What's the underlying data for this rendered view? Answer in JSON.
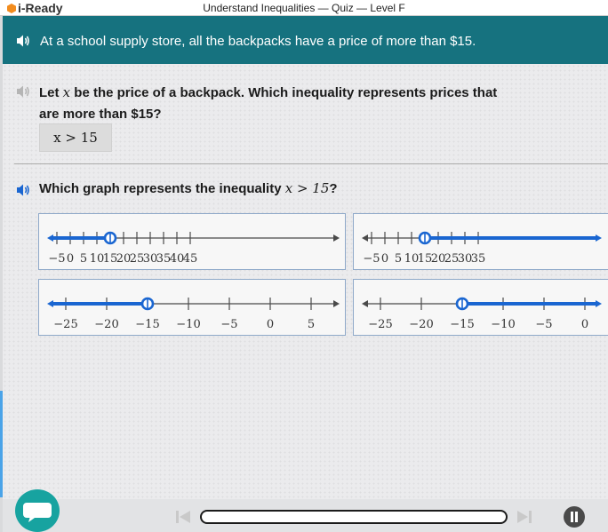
{
  "window": {
    "logo_text": "i-Ready",
    "title": "Understand Inequalities — Quiz — Level F"
  },
  "banner": {
    "text": "At a school supply store, all the backpacks have a price of more than $15."
  },
  "question1": {
    "prefix": "Let ",
    "variable": "x",
    "suffix": " be the price of a backpack. Which inequality represents prices that are more than $15?",
    "answer": "x > 15"
  },
  "question2": {
    "prefix": "Which graph represents the inequality ",
    "inequality": "x > 15",
    "suffix": "?"
  },
  "options": [
    {
      "id": "A",
      "min": -5,
      "max": 45,
      "ticks": [
        -5,
        0,
        5,
        10,
        15,
        20,
        25,
        30,
        35,
        40,
        45
      ],
      "labels": [
        "−5",
        "0",
        "5",
        "10",
        "15",
        "20",
        "25",
        "30",
        "35",
        "40",
        "45"
      ],
      "point": 15,
      "open": true,
      "direction": "left"
    },
    {
      "id": "B",
      "min": -5,
      "max": 40,
      "ticks": [
        -5,
        0,
        5,
        10,
        15,
        20,
        25,
        30,
        35
      ],
      "labels": [
        "−5",
        "0",
        "5",
        "10",
        "15",
        "20",
        "25",
        "30",
        "35"
      ],
      "point": 15,
      "open": true,
      "direction": "right"
    },
    {
      "id": "C",
      "min": -30,
      "max": 10,
      "ticks": [
        -25,
        -20,
        -15,
        -10,
        -5,
        0,
        5
      ],
      "labels": [
        "−25",
        "−20",
        "−15",
        "−10",
        "−5",
        "0",
        "5"
      ],
      "point": -15,
      "open": true,
      "direction": "left"
    },
    {
      "id": "D",
      "min": -30,
      "max": 5,
      "ticks": [
        -25,
        -20,
        -15,
        -10,
        -5,
        0
      ],
      "labels": [
        "−25",
        "−20",
        "−15",
        "−10",
        "−5",
        "0"
      ],
      "point": -15,
      "open": true,
      "direction": "right"
    }
  ],
  "colors": {
    "banner": "#16727f",
    "accent_blue": "#1a66d1",
    "chat_button": "#17a3a0"
  },
  "icons": {
    "speaker": "speaker-icon",
    "chat": "chat-bubble-icon",
    "prev": "skip-previous-icon",
    "next": "skip-next-icon",
    "pause": "pause-icon"
  },
  "progress": 0
}
